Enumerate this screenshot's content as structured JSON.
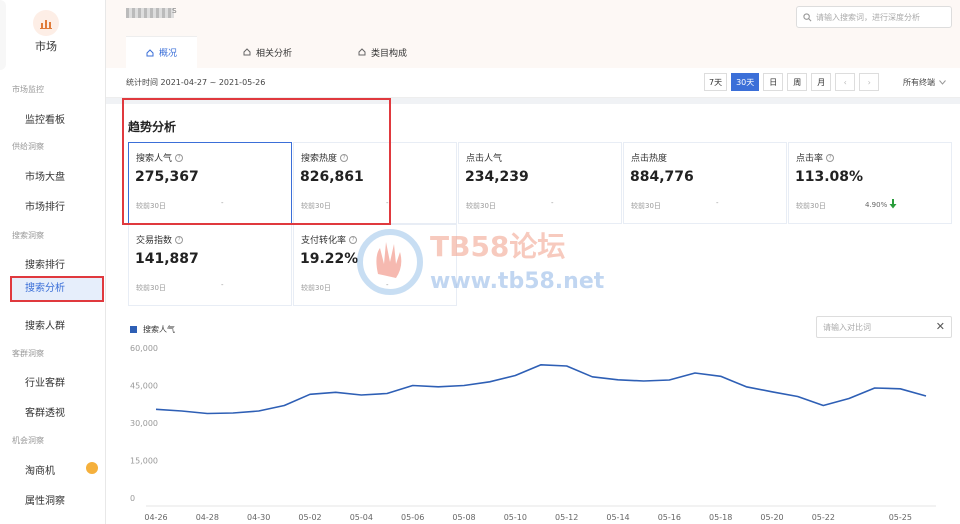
{
  "sidebar": {
    "logo_label": "市场",
    "groups": [
      {
        "label": "市场监控",
        "items": [
          {
            "label": "监控看板"
          }
        ]
      },
      {
        "label": "供给洞察",
        "items": [
          {
            "label": "市场大盘"
          },
          {
            "label": "市场排行"
          }
        ]
      },
      {
        "label": "搜索洞察",
        "items": [
          {
            "label": "搜索排行"
          },
          {
            "label": "搜索分析"
          },
          {
            "label": "搜索人群"
          }
        ]
      },
      {
        "label": "客群洞察",
        "items": [
          {
            "label": "行业客群"
          },
          {
            "label": "客群透视"
          }
        ]
      },
      {
        "label": "机会洞察",
        "items": [
          {
            "label": "淘商机"
          },
          {
            "label": "属性洞察"
          }
        ]
      }
    ],
    "active_item": "搜索分析"
  },
  "header": {
    "shop_suffix": "s",
    "search_placeholder": "请输入搜索词，进行深度分析",
    "tabs": [
      {
        "label": "概况"
      },
      {
        "label": "相关分析"
      },
      {
        "label": "类目构成"
      }
    ],
    "active_tab": "概况"
  },
  "filters": {
    "date_range": "统计时间 2021-04-27 ~ 2021-05-26",
    "periods": [
      "7天",
      "30天",
      "日",
      "周",
      "月"
    ],
    "active_period": "30天",
    "terminal": "所有终端"
  },
  "section": {
    "title": "趋势分析"
  },
  "metrics": [
    {
      "label": "搜索人气",
      "value": "275,367",
      "compare": "较前30日",
      "change": "-",
      "info": true
    },
    {
      "label": "搜索热度",
      "value": "826,861",
      "compare": "较前30日",
      "change": "-",
      "info": true
    },
    {
      "label": "点击人气",
      "value": "234,239",
      "compare": "较前30日",
      "change": "-",
      "info": false
    },
    {
      "label": "点击热度",
      "value": "884,776",
      "compare": "较前30日",
      "change": "-",
      "info": false
    },
    {
      "label": "点击率",
      "value": "113.08%",
      "compare": "较前30日",
      "change": "4.90%",
      "info": true
    },
    {
      "label": "交易指数",
      "value": "141,887",
      "compare": "较前30日",
      "change": "-",
      "info": true
    },
    {
      "label": "支付转化率",
      "value": "19.22%",
      "compare": "较前30日",
      "change": "-",
      "info": true
    }
  ],
  "compare_placeholder": "请输入对比词",
  "watermark": {
    "title": "TB58论坛",
    "url": "www.tb58.net"
  },
  "colors": {
    "accent": "#3b6fd8",
    "line": "#2e5fb5",
    "highlight": "#e0393e",
    "down": "#2a9d3c"
  },
  "chart_data": {
    "type": "line",
    "series": [
      {
        "name": "搜索人气",
        "values": [
          35500,
          34800,
          33800,
          34000,
          34800,
          37000,
          41500,
          42300,
          41200,
          41800,
          45000,
          44500,
          45000,
          46500,
          49000,
          53300,
          52800,
          48500,
          47300,
          46800,
          47200,
          50000,
          48700,
          44500,
          42500,
          40600,
          37000,
          39800,
          44000,
          43700,
          40800
        ]
      }
    ],
    "x": [
      "04-26",
      "04-27",
      "04-28",
      "04-29",
      "04-30",
      "05-01",
      "05-02",
      "05-03",
      "05-04",
      "05-05",
      "05-06",
      "05-07",
      "05-08",
      "05-09",
      "05-10",
      "05-11",
      "05-12",
      "05-13",
      "05-14",
      "05-15",
      "05-16",
      "05-17",
      "05-18",
      "05-19",
      "05-20",
      "05-21",
      "05-22",
      "05-23",
      "05-24",
      "05-25",
      "05-26"
    ],
    "x_tick_labels": [
      "04-26",
      "04-28",
      "04-30",
      "05-02",
      "05-04",
      "05-06",
      "05-08",
      "05-10",
      "05-12",
      "05-14",
      "05-16",
      "05-18",
      "05-20",
      "05-22",
      "05-25"
    ],
    "y_ticks": [
      "60,000",
      "45,000",
      "30,000",
      "15,000",
      "0"
    ],
    "ylim": [
      0,
      60000
    ],
    "grid": false,
    "legend": "top-left"
  }
}
